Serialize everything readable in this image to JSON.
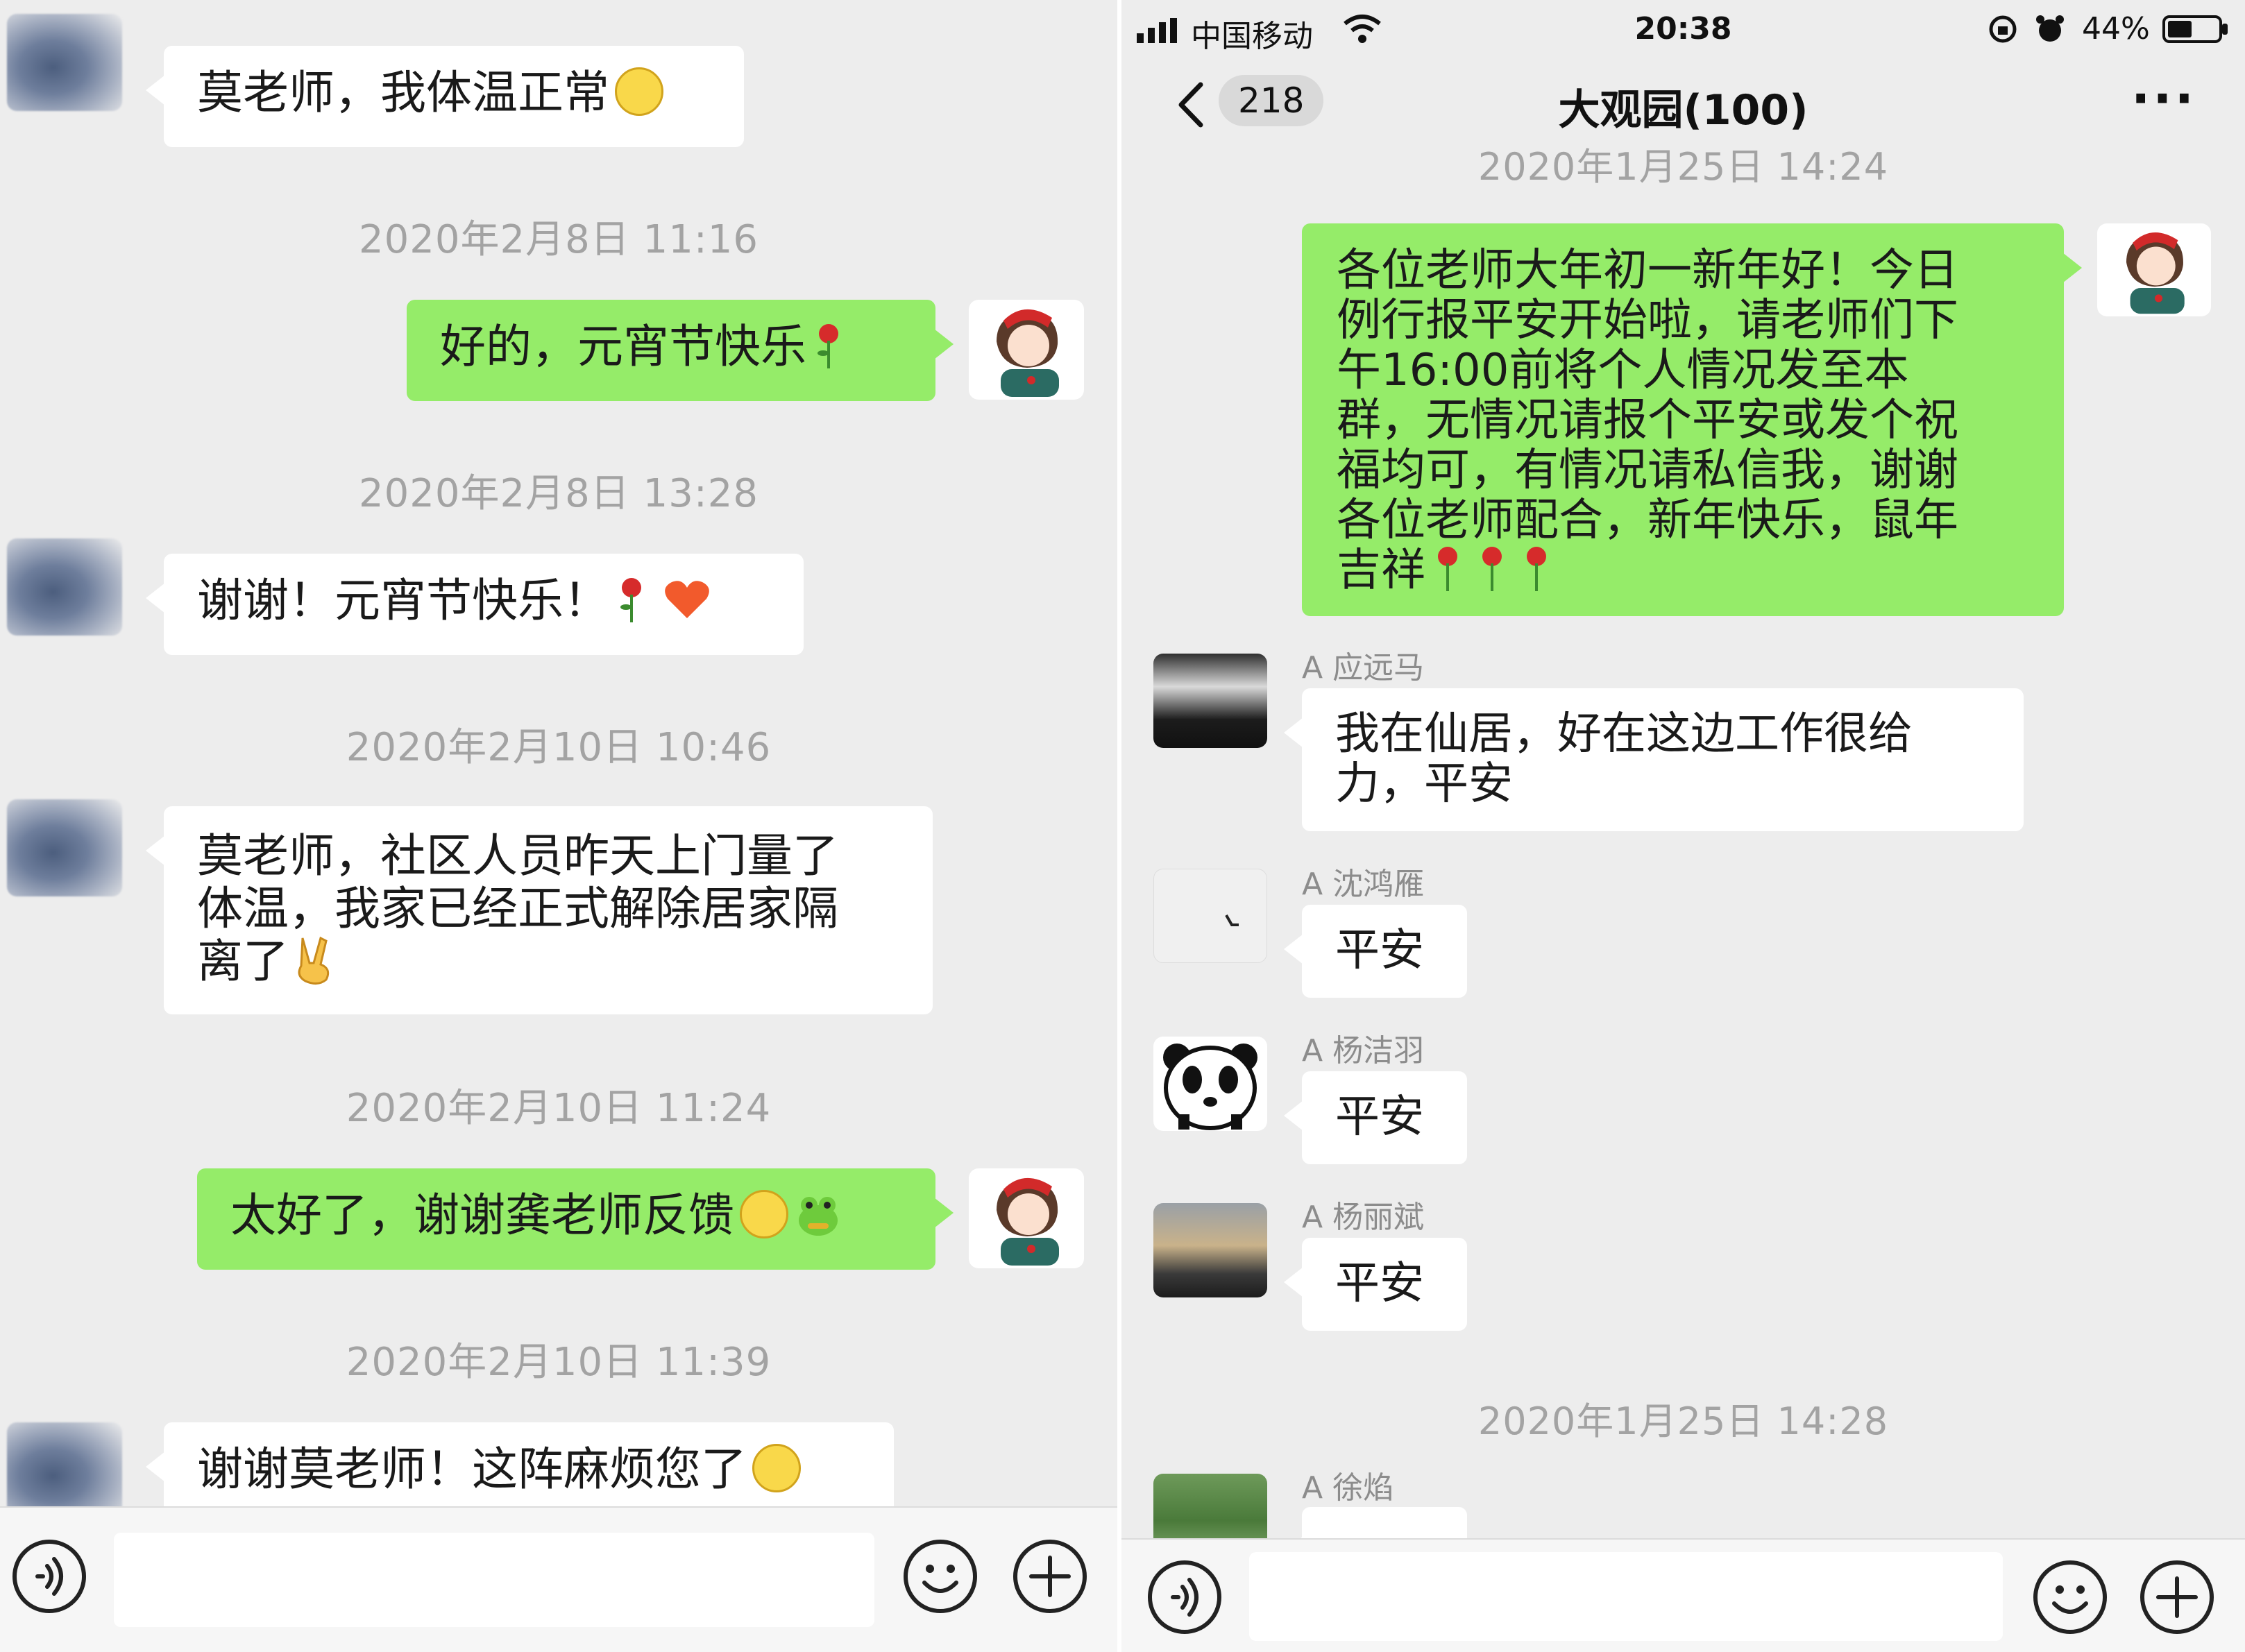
{
  "left": {
    "messages": [
      {
        "side": "in",
        "text": "莫老师，我体温正常"
      },
      {
        "time": "2020年2月8日 11:16"
      },
      {
        "side": "out",
        "text": "好的，元宵节快乐"
      },
      {
        "time": "2020年2月8日 13:28"
      },
      {
        "side": "in",
        "text": "谢谢！元宵节快乐！"
      },
      {
        "time": "2020年2月10日 10:46"
      },
      {
        "side": "in",
        "lines": [
          "莫老师，社区人员昨天上门量了",
          "体温，我家已经正式解除居家隔",
          "离了"
        ]
      },
      {
        "time": "2020年2月10日 11:24"
      },
      {
        "side": "out",
        "text": "太好了，谢谢龚老师反馈"
      },
      {
        "time": "2020年2月10日 11:39"
      },
      {
        "side": "in",
        "text": "谢谢莫老师！这阵麻烦您了"
      }
    ]
  },
  "right": {
    "status": {
      "carrier": "中国移动",
      "time": "20:38",
      "battery": "44%"
    },
    "nav": {
      "back_count": "218",
      "title": "大观园(100)",
      "more": "···"
    },
    "top_time": "2020年1月25日 14:24",
    "announcement": [
      "各位老师大年初一新年好！今日",
      "例行报平安开始啦，请老师们下",
      "午16:00前将个人情况发至本",
      "群，无情况请报个平安或发个祝",
      "福均可，有情况请私信我，谢谢",
      "各位老师配合，新年快乐，鼠年",
      "吉祥"
    ],
    "replies": [
      {
        "name": "A 应远马",
        "lines": [
          "我在仙居，好在这边工作很给",
          "力，平安"
        ]
      },
      {
        "name": "A 沈鸿雁",
        "lines": [
          "平安"
        ]
      },
      {
        "name": "A 杨洁羽",
        "lines": [
          "平安"
        ]
      },
      {
        "name": "A 杨丽斌",
        "lines": [
          "平安"
        ]
      }
    ],
    "bottom_time": "2020年1月25日 14:28",
    "last_name": "A 徐焰"
  },
  "icons": {
    "voice": "voice-icon",
    "emoji": "emoji-icon",
    "plus": "plus-icon",
    "back": "chevron-left-icon",
    "more": "more-icon"
  },
  "colors": {
    "outgoing_bubble": "#95ec69",
    "incoming_bubble": "#ffffff",
    "chat_background": "#ededed"
  }
}
